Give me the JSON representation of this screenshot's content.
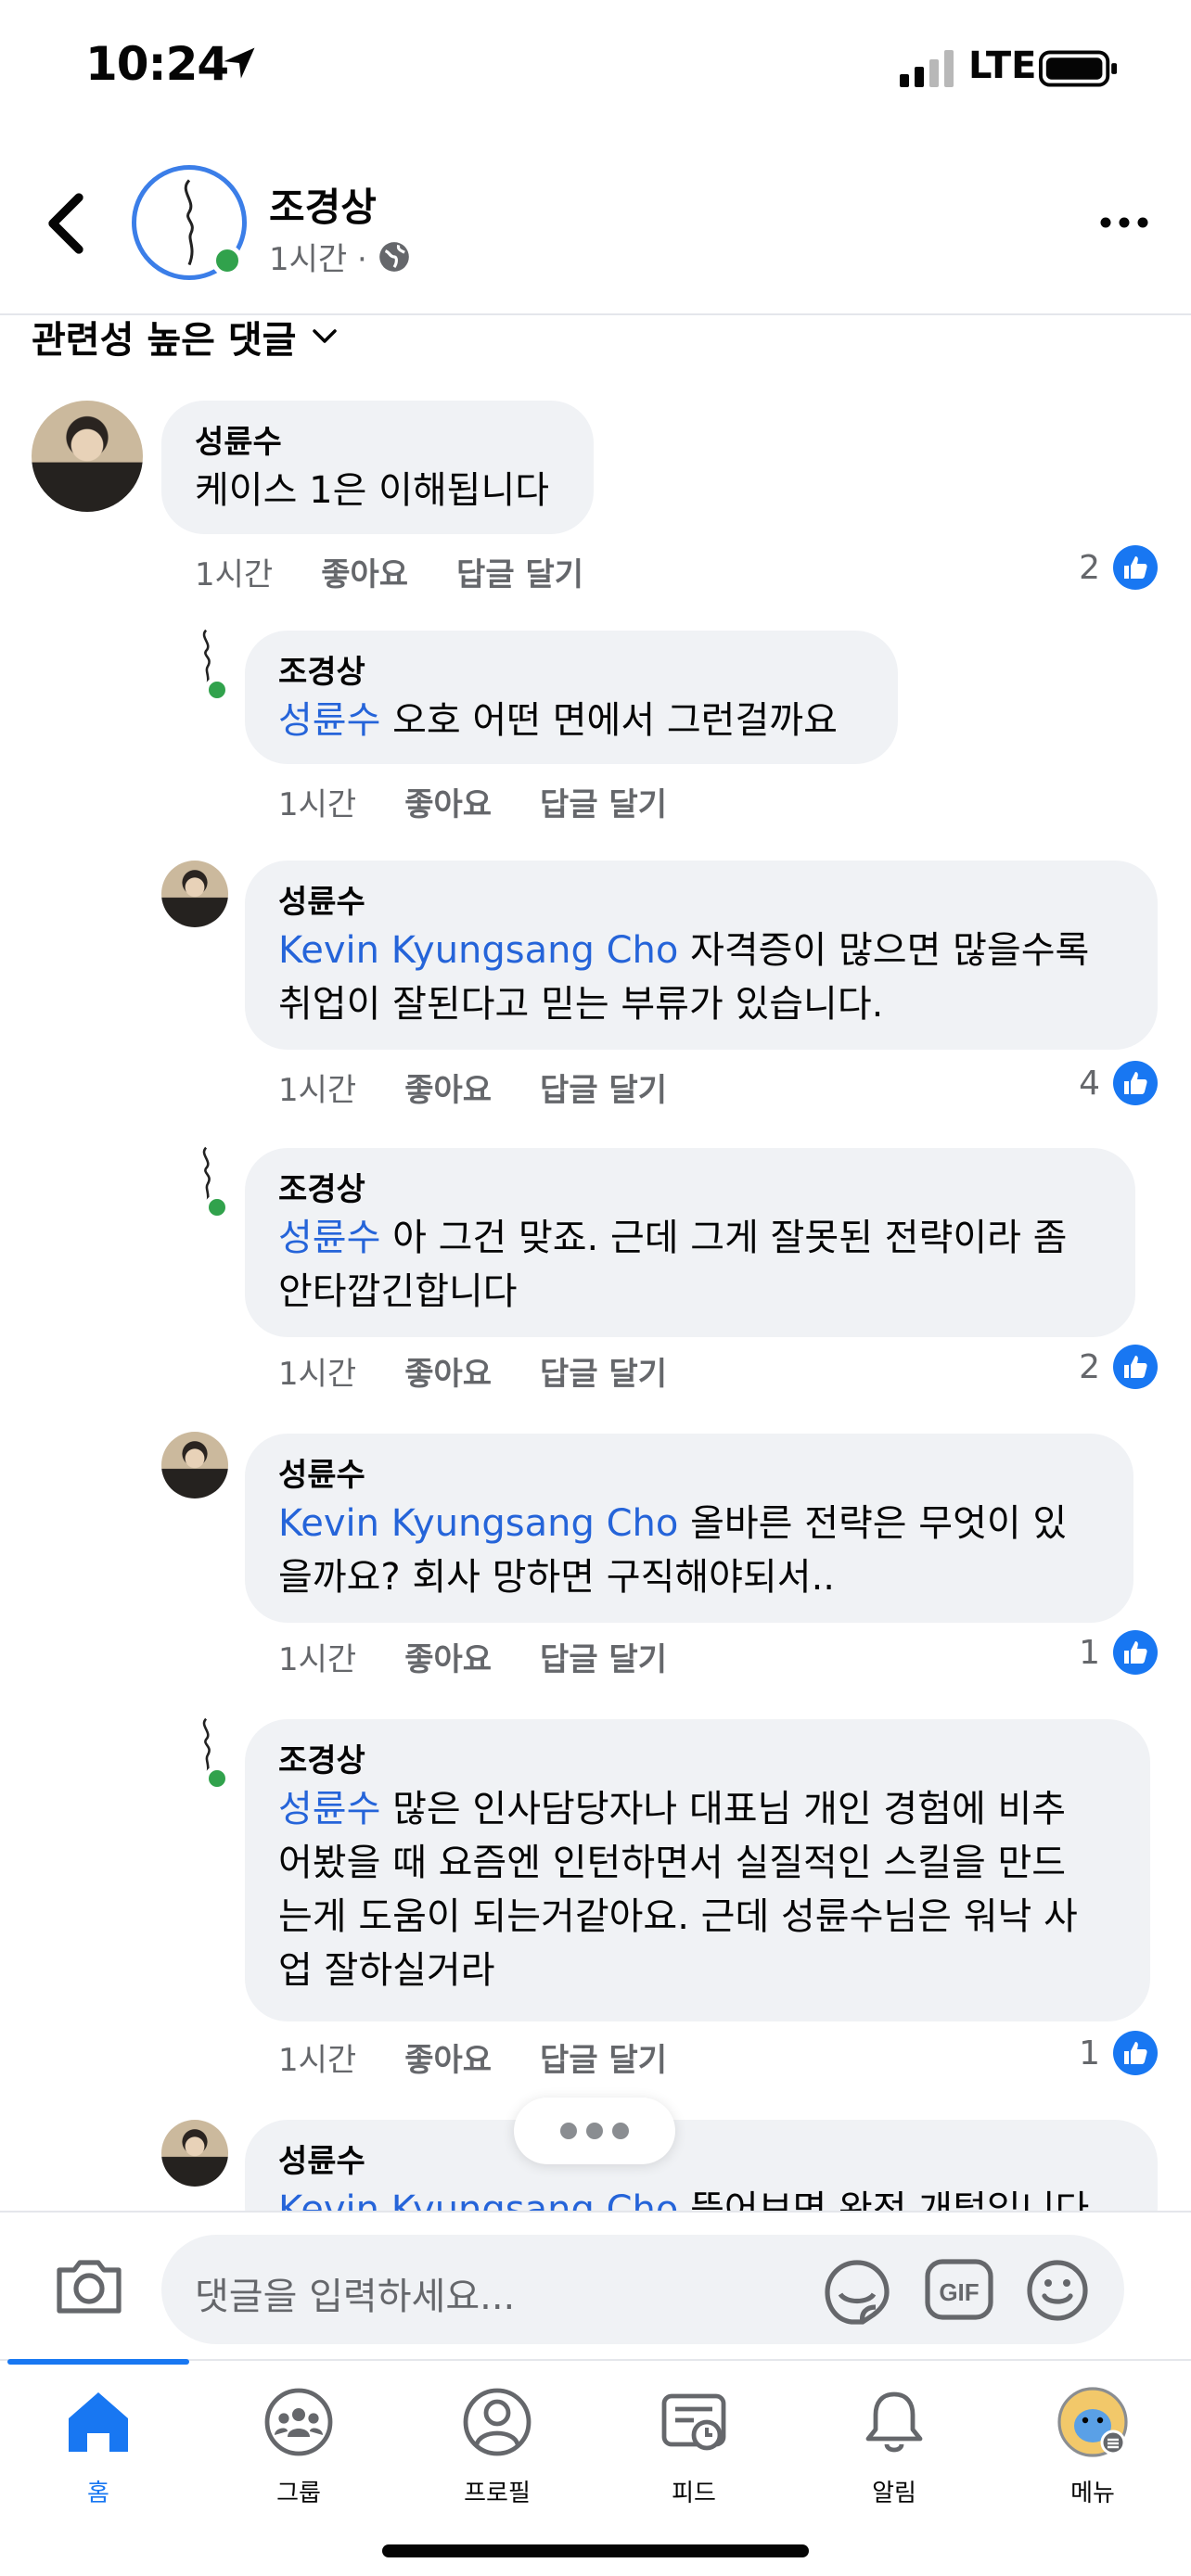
{
  "status_bar": {
    "time": "10:24",
    "network": "LTE"
  },
  "post_header": {
    "author": "조경상",
    "time_label": "1시간 ·"
  },
  "sort_label": "관련성 높은 댓글",
  "comments": [
    {
      "author": "성륜수",
      "mention": "",
      "text": "케이스 1은 이해됩니다",
      "text2": "",
      "time": "1시간",
      "like_label": "좋아요",
      "reply_label": "답글 달기",
      "likes": "2"
    },
    {
      "author": "조경상",
      "mention": "성륜수",
      "text": " 오호 어떤 면에서 그런걸까요",
      "text2": "",
      "time": "1시간",
      "like_label": "좋아요",
      "reply_label": "답글 달기",
      "likes": ""
    },
    {
      "author": "성륜수",
      "mention": "Kevin Kyungsang Cho",
      "text": " 자격증이 많으면 많을수록",
      "text2": "취업이 잘된다고 믿는 부류가 있습니다.",
      "time": "1시간",
      "like_label": "좋아요",
      "reply_label": "답글 달기",
      "likes": "4"
    },
    {
      "author": "조경상",
      "mention": "성륜수",
      "text": " 아 그건 맞죠. 근데 그게 잘못된 전략이라 좀",
      "text2": "안타깝긴합니다",
      "time": "1시간",
      "like_label": "좋아요",
      "reply_label": "답글 달기",
      "likes": "2"
    },
    {
      "author": "성륜수",
      "mention": "Kevin Kyungsang Cho",
      "text": " 올바른 전략은 무엇이 있",
      "text2": "을까요? 회사 망하면 구직해야되서..",
      "time": "1시간",
      "like_label": "좋아요",
      "reply_label": "답글 달기",
      "likes": "1"
    },
    {
      "author": "조경상",
      "mention": "성륜수",
      "text": " 많은 인사담당자나 대표님 개인 경험에 비추",
      "text2": "어봤을 때 요즘엔 인턴하면서 실질적인 스킬을 만드",
      "text3": "는게 도움이 되는거같아요. 근데 성륜수님은 워낙 사",
      "text4": "업 잘하실거라",
      "time": "1시간",
      "like_label": "좋아요",
      "reply_label": "답글 달기",
      "likes": "1"
    },
    {
      "author": "성륜수",
      "mention": "Kevin Kyungsang Cho",
      "text": " 뜯어보면 완전 개털입니다",
      "text2": ""
    }
  ],
  "composer": {
    "placeholder": "댓글을 입력하세요...",
    "gif_label": "GIF"
  },
  "tabs": [
    {
      "label": "홈",
      "icon": "home-icon",
      "active": true
    },
    {
      "label": "그룹",
      "icon": "groups-icon"
    },
    {
      "label": "프로필",
      "icon": "profile-icon"
    },
    {
      "label": "피드",
      "icon": "feeds-icon"
    },
    {
      "label": "알림",
      "icon": "bell-icon"
    },
    {
      "label": "메뉴",
      "icon": "menu-avatar-icon"
    }
  ],
  "colors": {
    "accent": "#1877f2",
    "mention": "#2564d9",
    "bubble": "#f0f2f5",
    "online": "#31a24c"
  }
}
